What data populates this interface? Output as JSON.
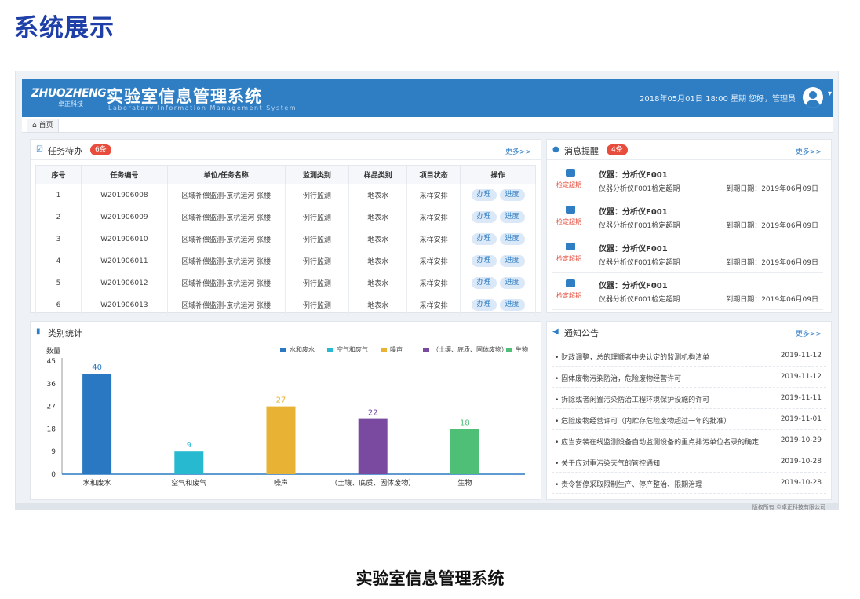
{
  "page_heading": "系统展示",
  "caption": "实验室信息管理系统",
  "header": {
    "logo_main": "ZHUOZHENG",
    "logo_sub": "卓正科技",
    "title": "实验室信息管理系统",
    "subtitle": "Laboratory Information Management System",
    "datetime": "2018年05月01日 18:00 星期",
    "greeting": "您好，管理员",
    "brand_color": "#2f7ec4"
  },
  "tabs": {
    "home": "首页"
  },
  "tasks_panel": {
    "title": "任务待办",
    "badge": "6条",
    "more": "更多>>",
    "columns": [
      "序号",
      "任务编号",
      "单位/任务名称",
      "监测类别",
      "样品类别",
      "项目状态",
      "操作"
    ],
    "rows": [
      {
        "no": "1",
        "code": "W201906008",
        "unit": "区域补偿监测-京杭运河 张楼",
        "type": "例行监测",
        "sample": "地表水",
        "status": "采样安排"
      },
      {
        "no": "2",
        "code": "W201906009",
        "unit": "区域补偿监测-京杭运河 张楼",
        "type": "例行监测",
        "sample": "地表水",
        "status": "采样安排"
      },
      {
        "no": "3",
        "code": "W201906010",
        "unit": "区域补偿监测-京杭运河 张楼",
        "type": "例行监测",
        "sample": "地表水",
        "status": "采样安排"
      },
      {
        "no": "4",
        "code": "W201906011",
        "unit": "区域补偿监测-京杭运河 张楼",
        "type": "例行监测",
        "sample": "地表水",
        "status": "采样安排"
      },
      {
        "no": "5",
        "code": "W201906012",
        "unit": "区域补偿监测-京杭运河 张楼",
        "type": "例行监测",
        "sample": "地表水",
        "status": "采样安排"
      },
      {
        "no": "6",
        "code": "W201906013",
        "unit": "区域补偿监测-京杭运河 张楼",
        "type": "例行监测",
        "sample": "地表水",
        "status": "采样安排"
      }
    ],
    "action_do": "办理",
    "action_progress": "进度"
  },
  "reminder_panel": {
    "title": "消息提醒",
    "badge": "4条",
    "more": "更多>>",
    "items": [
      {
        "tag": "检定超期",
        "name": "仪器：分析仪F001",
        "desc": "仪器分析仪F001检定超期",
        "date": "到期日期：2019年06月09日"
      },
      {
        "tag": "检定超期",
        "name": "仪器：分析仪F001",
        "desc": "仪器分析仪F001检定超期",
        "date": "到期日期：2019年06月09日"
      },
      {
        "tag": "检定超期",
        "name": "仪器：分析仪F001",
        "desc": "仪器分析仪F001检定超期",
        "date": "到期日期：2019年06月09日"
      },
      {
        "tag": "检定超期",
        "name": "仪器：分析仪F001",
        "desc": "仪器分析仪F001检定超期",
        "date": "到期日期：2019年06月09日"
      }
    ]
  },
  "stats_panel": {
    "title": "类别统计"
  },
  "notice_panel": {
    "title": "通知公告",
    "more": "更多>>",
    "items": [
      {
        "title": "• 财政调整，总的理顺者中央认定的监测机构清单",
        "date": "2019-11-12"
      },
      {
        "title": "• 固体废物污染防治，危险废物经营许可",
        "date": "2019-11-12"
      },
      {
        "title": "• 拆除或者闲置污染防治工程环境保护设施的许可",
        "date": "2019-11-11"
      },
      {
        "title": "• 危险废物经营许可（内贮存危险废物超过一年的批准）",
        "date": "2019-11-01"
      },
      {
        "title": "• 应当安装在线监测设备自动监测设备的重点排污单位名录的确定",
        "date": "2019-10-29"
      },
      {
        "title": "• 关于应对重污染天气的管控通知",
        "date": "2019-10-28"
      },
      {
        "title": "• 责令暂停采取限制生产、停产整治、限期治理",
        "date": "2019-10-28"
      }
    ]
  },
  "footer": {
    "text": "版权所有 ©卓正科技有限公司"
  },
  "chart_data": {
    "type": "bar",
    "ylabel": "数量",
    "categories": [
      "水和废水",
      "空气和废气",
      "噪声",
      "（土壤、底质、固体废物）",
      "生物"
    ],
    "values": [
      40,
      9,
      27,
      22,
      18
    ],
    "colors": [
      "#2a78c2",
      "#27b9d0",
      "#e8b234",
      "#7a4aa0",
      "#4fbf78"
    ],
    "legend": [
      "水和废水",
      "空气和废气",
      "噪声",
      "（土壤、底质、固体废物）",
      "生物"
    ],
    "yticks": [
      0,
      9,
      18,
      27,
      36,
      45
    ],
    "ylim": [
      0,
      45
    ],
    "legend_position": "top-right",
    "grid": false
  }
}
